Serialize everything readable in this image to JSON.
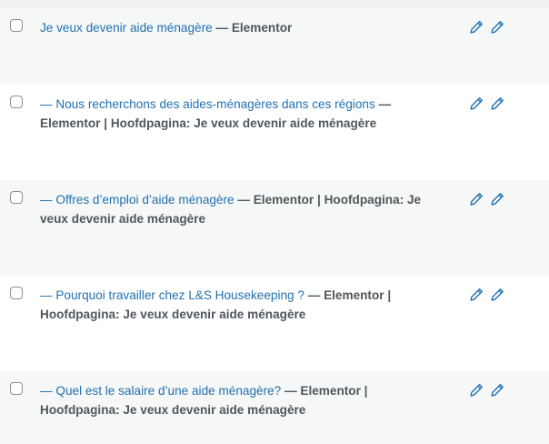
{
  "rows": [
    {
      "title": "Je veux devenir aide ménagère",
      "state": "— Elementor"
    },
    {
      "title": "— Nous recherchons des aides-ménagères dans ces régions",
      "state": "— Elementor | Hoofdpagina: Je veux devenir aide ménagère"
    },
    {
      "title": "— Offres d’emploi d’aide ménagère",
      "state": "— Elementor | Hoofdpagina: Je veux devenir aide ménagère"
    },
    {
      "title": "— Pourquoi travailler chez L&S Housekeeping ?",
      "state": "— Elementor | Hoofdpagina: Je veux devenir aide ménagère"
    },
    {
      "title": "— Quel est le salaire d’une aide ménagère?",
      "state": "— Elementor | Hoofdpagina: Je veux devenir aide ménagère"
    }
  ],
  "icons": {
    "edit": "pencil-icon",
    "quick_edit": "pencil-icon"
  },
  "colors": {
    "link": "#2271b1",
    "text": "#3c434a",
    "row_alt": "#f6f7f7",
    "row_plain": "#ffffff"
  }
}
